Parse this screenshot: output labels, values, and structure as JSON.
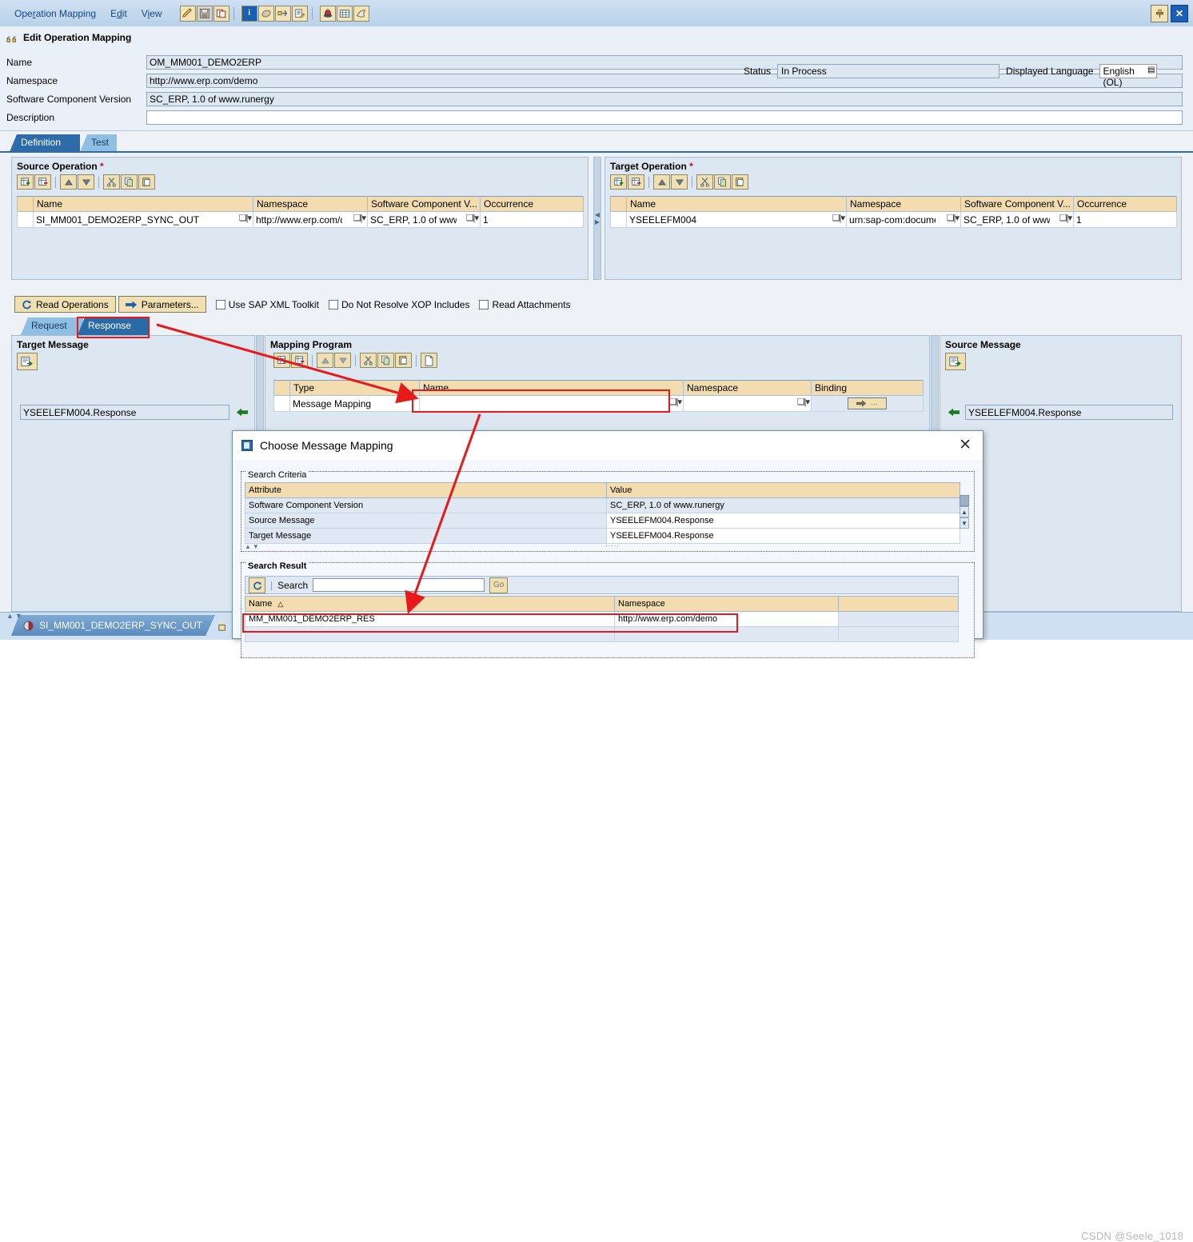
{
  "window": {
    "menu": [
      {
        "label": "Operation Mapping",
        "accel": "r"
      },
      {
        "label": "Edit",
        "accel": "d"
      },
      {
        "label": "View",
        "accel": "i"
      }
    ],
    "toolbar_groups": [
      [
        "edit-pencil-icon",
        "save-icon",
        "copy-window-icon"
      ],
      [
        "info-icon",
        "book-icon",
        "where-used-icon",
        "edit-properties-icon"
      ],
      [
        "ink-icon",
        "grid-icon",
        "history-icon"
      ]
    ],
    "window_buttons": [
      "pin-icon",
      "close-icon"
    ]
  },
  "header": {
    "title": "Edit Operation Mapping",
    "fields": [
      {
        "label": "Name",
        "value": "OM_MM001_DEMO2ERP"
      },
      {
        "label": "Namespace",
        "value": "http://www.erp.com/demo"
      },
      {
        "label": "Software Component Version",
        "value": "SC_ERP, 1.0 of www.runergy"
      },
      {
        "label": "Description",
        "value": ""
      }
    ],
    "status_label": "Status",
    "status_value": "In Process",
    "language_label": "Displayed Language",
    "language_value": "English (OL)"
  },
  "main_tabs": [
    {
      "label": "Definition",
      "active": true
    },
    {
      "label": "Test",
      "active": false
    }
  ],
  "source_operation": {
    "title": "Source Operation",
    "required": "*",
    "columns": [
      "Name",
      "Namespace",
      "Software Component V...",
      "Occurrence"
    ],
    "rows": [
      {
        "name": "SI_MM001_DEMO2ERP_SYNC_OUT",
        "namespace": "http://www.erp.com/d",
        "scv": "SC_ERP, 1.0 of www",
        "occurrence": "1"
      }
    ],
    "toolbar": [
      "insert-row-icon",
      "delete-row-icon",
      "move-up-icon",
      "move-down-icon",
      "cut-icon",
      "copy-icon",
      "paste-icon"
    ]
  },
  "target_operation": {
    "title": "Target Operation",
    "required": "*",
    "columns": [
      "Name",
      "Namespace",
      "Software Component V...",
      "Occurrence"
    ],
    "rows": [
      {
        "name": "YSEELEFM004",
        "namespace": "urn:sap-com:docume",
        "scv": "SC_ERP, 1.0 of www",
        "occurrence": "1"
      }
    ],
    "toolbar": [
      "insert-row-icon",
      "delete-row-icon",
      "move-up-icon",
      "move-down-icon",
      "cut-icon",
      "copy-icon",
      "paste-icon"
    ]
  },
  "options": {
    "read_operations_label": "Read Operations",
    "parameters_label": "Parameters...",
    "checkboxes": [
      {
        "label": "Use SAP XML Toolkit",
        "checked": false
      },
      {
        "label": "Do Not Resolve XOP Includes",
        "checked": false
      },
      {
        "label": "Read Attachments",
        "checked": false
      }
    ]
  },
  "sub_tabs": [
    {
      "label": "Request",
      "active": false
    },
    {
      "label": "Response",
      "active": true
    }
  ],
  "target_message": {
    "title": "Target Message",
    "value": "YSEELEFM004.Response",
    "toolbar": [
      "open-object-icon"
    ]
  },
  "source_message": {
    "title": "Source Message",
    "value": "YSEELEFM004.Response",
    "toolbar": [
      "open-object-icon"
    ]
  },
  "mapping_program": {
    "title": "Mapping Program",
    "columns": [
      "Type",
      "Name",
      "Namespace",
      "Binding"
    ],
    "rows": [
      {
        "type": "Message Mapping",
        "name": "",
        "namespace": "",
        "binding": "binding-button"
      }
    ],
    "toolbar": [
      "insert-row-icon",
      "delete-row-icon",
      "move-up-icon",
      "move-down-icon",
      "cut-icon",
      "copy-icon",
      "paste-icon",
      "new-doc-icon"
    ]
  },
  "dialog": {
    "title": "Choose Message Mapping",
    "close_label": "✕",
    "search_criteria": {
      "caption": "Search Criteria",
      "columns": [
        "Attribute",
        "Value"
      ],
      "rows": [
        {
          "attribute": "Software Component Version",
          "value": "SC_ERP, 1.0 of www.runergy"
        },
        {
          "attribute": "Source Message",
          "value": "YSEELEFM004.Response"
        },
        {
          "attribute": "Target Message",
          "value": "YSEELEFM004.Response"
        }
      ]
    },
    "search_result": {
      "caption": "Search Result",
      "search_label": "Search",
      "search_value": "",
      "go_label": "Go",
      "refresh_icon": "refresh-icon",
      "columns": [
        "Name",
        "Namespace"
      ],
      "sort_indicator": "△",
      "rows": [
        {
          "name": "MM_MM001_DEMO2ERP_RES",
          "namespace": "http://www.erp.com/demo"
        }
      ]
    }
  },
  "footer": {
    "object_tab": "SI_MM001_DEMO2ERP_SYNC_OUT",
    "object_icon": "interface-object-icon",
    "lock_icon": "unlocked-icon",
    "watermark": "CSDN @Seele_1018"
  },
  "colors": {
    "accent": "#2d6ca8",
    "highlight": "#fdbe2e",
    "header_cell": "#f3ddb0",
    "annotation": "#e8191a",
    "panel": "#dde7f1"
  }
}
